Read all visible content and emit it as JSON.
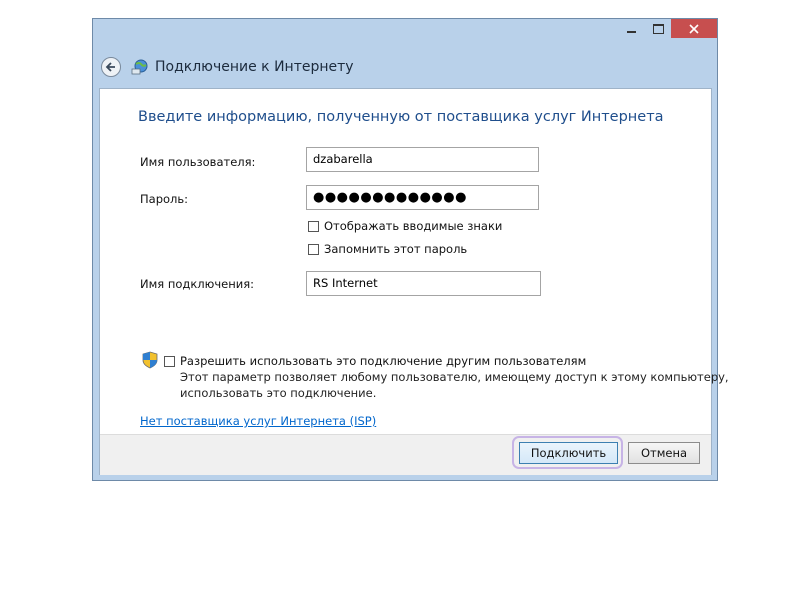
{
  "window": {
    "title": "Подключение к Интернету",
    "icons": {
      "back": "back-arrow-icon",
      "app": "network-globe-icon",
      "minimize": "minimize-icon",
      "maximize": "maximize-icon",
      "close": "close-icon"
    },
    "accent_color": "#1f4e8c",
    "close_color": "#c74f4f"
  },
  "form": {
    "heading": "Введите информацию, полученную от поставщика услуг Интернета",
    "username": {
      "label": "Имя пользователя:",
      "value": "dzabarella"
    },
    "password": {
      "label": "Пароль:",
      "value": "●●●●●●●●●●●●●"
    },
    "show_chars": {
      "label": "Отображать вводимые знаки",
      "checked": false
    },
    "remember": {
      "label": "Запомнить этот пароль",
      "checked": false
    },
    "connection_name": {
      "label": "Имя подключения:",
      "value": "RS Internet"
    },
    "allow_others": {
      "label": "Разрешить использовать это подключение другим пользователям",
      "checked": false,
      "icon": "uac-shield-icon",
      "description_line1": "Этот параметр позволяет любому пользователю, имеющему доступ к этому компьютеру,",
      "description_line2": "использовать это подключение."
    },
    "no_isp_link": "Нет поставщика услуг Интернета (ISP)"
  },
  "footer": {
    "connect_label": "Подключить",
    "cancel_label": "Отмена"
  }
}
